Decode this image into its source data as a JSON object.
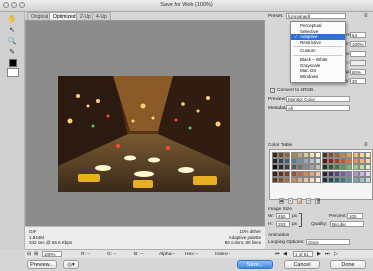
{
  "window": {
    "title": "Save for Web (100%)"
  },
  "tabs": [
    {
      "label": "Original",
      "active": false
    },
    {
      "label": "Optimized",
      "active": true
    },
    {
      "label": "2-Up",
      "active": false
    },
    {
      "label": "4-Up",
      "active": false
    }
  ],
  "image_info": {
    "left": [
      "GIF",
      "1.844M",
      "342 sec @ 56.6 Kbps"
    ],
    "right": [
      "10% dither",
      "Adaptive palette",
      "80 colors, 80 lines"
    ]
  },
  "preset": {
    "label": "Preset:",
    "value": "[Unnamed]"
  },
  "dropdown": {
    "items": [
      "Perceptual",
      "Selective",
      "Adaptive",
      "Restrictive",
      "Custom",
      "Black – White",
      "Grayscale",
      "Mac OS",
      "Windows"
    ],
    "selected": "Adaptive"
  },
  "settings": {
    "colors_label": "Colors:",
    "colors_value": "64",
    "dither_label": "Dither:",
    "dither_value": "100%",
    "matte_label": "Matte:",
    "amount_label": "Amount:",
    "websnap_label": "Web Snap:",
    "websnap_value": "80%",
    "lossy_label": "Lossy:",
    "lossy_value": "30"
  },
  "convert_srgb": {
    "label": "Convert to sRGB"
  },
  "preview_row": {
    "label": "Preview:",
    "value": "Monitor Color"
  },
  "metadata_row": {
    "label": "Metadata:",
    "value": "All"
  },
  "color_table": {
    "label": "Color Table"
  },
  "image_size": {
    "label": "Image Size",
    "w_label": "W:",
    "w_value": "450",
    "w_unit": "px",
    "h_label": "H:",
    "h_value": "253",
    "h_unit": "px",
    "percent_label": "Percent:",
    "percent_value": "100",
    "quality_label": "Quality:",
    "quality_value": "Bicubic"
  },
  "animation": {
    "label": "Animation",
    "looping_label": "Looping Options:",
    "looping_value": "Once",
    "frame_counter": "1 of 51"
  },
  "status": {
    "zoom": "100%",
    "r": "R:",
    "r_val": "--",
    "g": "G:",
    "g_val": "--",
    "b": "B:",
    "b_val": "--",
    "alpha": "Alpha:",
    "alpha_val": "--",
    "hex": "Hex:",
    "hex_val": "--",
    "index": "Index:",
    "index_val": "--"
  },
  "buttons": {
    "preview": "Preview...",
    "save": "Save...",
    "cancel": "Cancel",
    "done": "Done"
  },
  "swatches": [
    "#3a2a1a",
    "#6b4a2a",
    "#8a6a3a",
    "#a88a50",
    "#c8a870",
    "#e0c898",
    "#f0e0b8",
    "#fff4d8",
    "#4a3020",
    "#7a5030",
    "#9a6838",
    "#b88848",
    "#d8a858",
    "#e8c070",
    "#f8d890",
    "#fff0b0",
    "#202830",
    "#304050",
    "#406078",
    "#5a7898",
    "#7890b0",
    "#98a8c0",
    "#b8c0d0",
    "#d8dce6",
    "#5a1a10",
    "#8a2818",
    "#b03820",
    "#d05028",
    "#e87038",
    "#f09050",
    "#f8b070",
    "#fcd0a0",
    "#101010",
    "#282828",
    "#404040",
    "#585858",
    "#707070",
    "#888888",
    "#a0a0a0",
    "#c0c0c0",
    "#1a3a1a",
    "#2a5a2a",
    "#3a7a3a",
    "#5a9a4a",
    "#7aba6a",
    "#9ad088",
    "#bae0a8",
    "#dcf0cc",
    "#402010",
    "#603018",
    "#804020",
    "#a05030",
    "#c06840",
    "#d08858",
    "#e0a878",
    "#f0c8a0",
    "#2a2040",
    "#403060",
    "#584880",
    "#7060a0",
    "#8878b8",
    "#a898cc",
    "#c8b8e0",
    "#e4dcf0",
    "#603820",
    "#805030",
    "#a07048",
    "#c09060",
    "#d8b080",
    "#e8c8a0",
    "#f4dcc0",
    "#fff0e0",
    "#183040",
    "#204858",
    "#306070",
    "#407888",
    "#5890a0",
    "#78a8b8",
    "#98c0cc",
    "#c0dce4"
  ]
}
